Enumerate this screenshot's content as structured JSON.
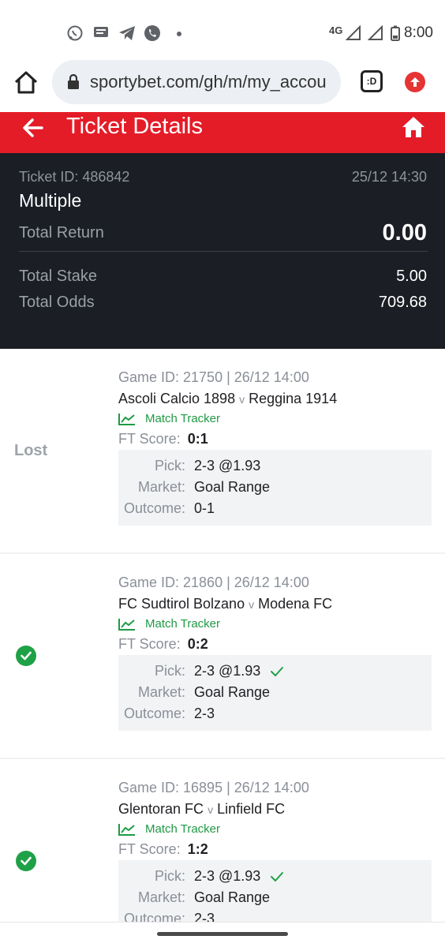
{
  "status_bar": {
    "network": "4G",
    "time": "8:00",
    "icons": [
      "whatsapp-icon",
      "message-icon",
      "telegram-icon",
      "phone-icon",
      "dot-icon",
      "signal-icon",
      "signal-icon",
      "battery-icon"
    ]
  },
  "browser": {
    "url": "sportybet.com/gh/m/my_accou",
    "tab_count": ":D"
  },
  "header": {
    "title": "Ticket Details"
  },
  "summary": {
    "ticket_id": "Ticket ID: 486842",
    "date": "25/12 14:30",
    "type": "Multiple",
    "total_return_label": "Total Return",
    "total_return": "0.00",
    "total_stake_label": "Total Stake",
    "total_stake": "5.00",
    "total_odds_label": "Total Odds",
    "total_odds": "709.68"
  },
  "labels": {
    "match_tracker": "Match Tracker",
    "ft_score": "FT Score:",
    "pick": "Pick:",
    "market": "Market:",
    "outcome": "Outcome:",
    "vs": "v"
  },
  "bets": [
    {
      "status": "Lost",
      "won": false,
      "game_id": "Game ID: 21750 | 26/12 14:00",
      "home": "Ascoli Calcio 1898",
      "away": "Reggina 1914",
      "ft_score": "0:1",
      "pick": "2-3 @1.93",
      "market": "Goal Range",
      "outcome": "0-1"
    },
    {
      "status": "Won",
      "won": true,
      "game_id": "Game ID: 21860 | 26/12 14:00",
      "home": "FC Sudtirol Bolzano",
      "away": "Modena FC",
      "ft_score": "0:2",
      "pick": "2-3 @1.93",
      "market": "Goal Range",
      "outcome": "2-3"
    },
    {
      "status": "Won",
      "won": true,
      "game_id": "Game ID: 16895 | 26/12 14:00",
      "home": "Glentoran FC",
      "away": "Linfield FC",
      "ft_score": "1:2",
      "pick": "2-3 @1.93",
      "market": "Goal Range",
      "outcome": "2-3"
    }
  ],
  "colors": {
    "brand_red": "#e41c28",
    "summary_bg": "#1b1e25",
    "win_green": "#1fa147",
    "tracker_green": "#1e9a44"
  }
}
